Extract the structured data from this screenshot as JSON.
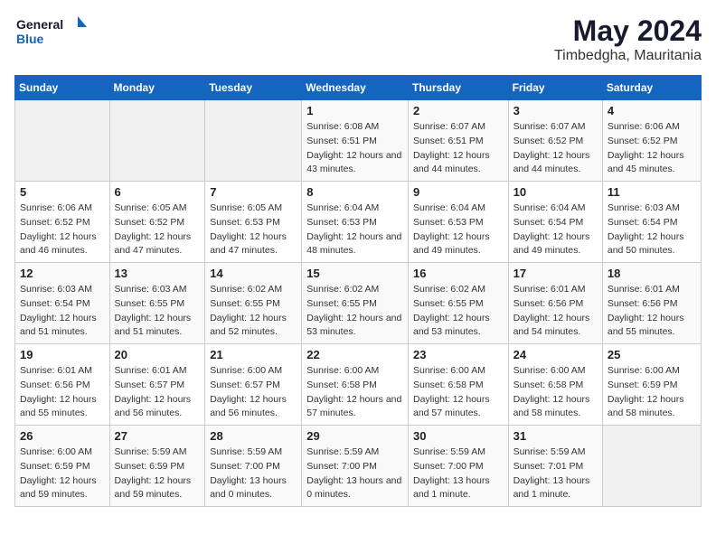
{
  "logo": {
    "text_general": "General",
    "text_blue": "Blue"
  },
  "title": "May 2024",
  "subtitle": "Timbedgha, Mauritania",
  "headers": [
    "Sunday",
    "Monday",
    "Tuesday",
    "Wednesday",
    "Thursday",
    "Friday",
    "Saturday"
  ],
  "weeks": [
    [
      {
        "day": "",
        "info": ""
      },
      {
        "day": "",
        "info": ""
      },
      {
        "day": "",
        "info": ""
      },
      {
        "day": "1",
        "sunrise": "Sunrise: 6:08 AM",
        "sunset": "Sunset: 6:51 PM",
        "daylight": "Daylight: 12 hours and 43 minutes."
      },
      {
        "day": "2",
        "sunrise": "Sunrise: 6:07 AM",
        "sunset": "Sunset: 6:51 PM",
        "daylight": "Daylight: 12 hours and 44 minutes."
      },
      {
        "day": "3",
        "sunrise": "Sunrise: 6:07 AM",
        "sunset": "Sunset: 6:52 PM",
        "daylight": "Daylight: 12 hours and 44 minutes."
      },
      {
        "day": "4",
        "sunrise": "Sunrise: 6:06 AM",
        "sunset": "Sunset: 6:52 PM",
        "daylight": "Daylight: 12 hours and 45 minutes."
      }
    ],
    [
      {
        "day": "5",
        "sunrise": "Sunrise: 6:06 AM",
        "sunset": "Sunset: 6:52 PM",
        "daylight": "Daylight: 12 hours and 46 minutes."
      },
      {
        "day": "6",
        "sunrise": "Sunrise: 6:05 AM",
        "sunset": "Sunset: 6:52 PM",
        "daylight": "Daylight: 12 hours and 47 minutes."
      },
      {
        "day": "7",
        "sunrise": "Sunrise: 6:05 AM",
        "sunset": "Sunset: 6:53 PM",
        "daylight": "Daylight: 12 hours and 47 minutes."
      },
      {
        "day": "8",
        "sunrise": "Sunrise: 6:04 AM",
        "sunset": "Sunset: 6:53 PM",
        "daylight": "Daylight: 12 hours and 48 minutes."
      },
      {
        "day": "9",
        "sunrise": "Sunrise: 6:04 AM",
        "sunset": "Sunset: 6:53 PM",
        "daylight": "Daylight: 12 hours and 49 minutes."
      },
      {
        "day": "10",
        "sunrise": "Sunrise: 6:04 AM",
        "sunset": "Sunset: 6:54 PM",
        "daylight": "Daylight: 12 hours and 49 minutes."
      },
      {
        "day": "11",
        "sunrise": "Sunrise: 6:03 AM",
        "sunset": "Sunset: 6:54 PM",
        "daylight": "Daylight: 12 hours and 50 minutes."
      }
    ],
    [
      {
        "day": "12",
        "sunrise": "Sunrise: 6:03 AM",
        "sunset": "Sunset: 6:54 PM",
        "daylight": "Daylight: 12 hours and 51 minutes."
      },
      {
        "day": "13",
        "sunrise": "Sunrise: 6:03 AM",
        "sunset": "Sunset: 6:55 PM",
        "daylight": "Daylight: 12 hours and 51 minutes."
      },
      {
        "day": "14",
        "sunrise": "Sunrise: 6:02 AM",
        "sunset": "Sunset: 6:55 PM",
        "daylight": "Daylight: 12 hours and 52 minutes."
      },
      {
        "day": "15",
        "sunrise": "Sunrise: 6:02 AM",
        "sunset": "Sunset: 6:55 PM",
        "daylight": "Daylight: 12 hours and 53 minutes."
      },
      {
        "day": "16",
        "sunrise": "Sunrise: 6:02 AM",
        "sunset": "Sunset: 6:55 PM",
        "daylight": "Daylight: 12 hours and 53 minutes."
      },
      {
        "day": "17",
        "sunrise": "Sunrise: 6:01 AM",
        "sunset": "Sunset: 6:56 PM",
        "daylight": "Daylight: 12 hours and 54 minutes."
      },
      {
        "day": "18",
        "sunrise": "Sunrise: 6:01 AM",
        "sunset": "Sunset: 6:56 PM",
        "daylight": "Daylight: 12 hours and 55 minutes."
      }
    ],
    [
      {
        "day": "19",
        "sunrise": "Sunrise: 6:01 AM",
        "sunset": "Sunset: 6:56 PM",
        "daylight": "Daylight: 12 hours and 55 minutes."
      },
      {
        "day": "20",
        "sunrise": "Sunrise: 6:01 AM",
        "sunset": "Sunset: 6:57 PM",
        "daylight": "Daylight: 12 hours and 56 minutes."
      },
      {
        "day": "21",
        "sunrise": "Sunrise: 6:00 AM",
        "sunset": "Sunset: 6:57 PM",
        "daylight": "Daylight: 12 hours and 56 minutes."
      },
      {
        "day": "22",
        "sunrise": "Sunrise: 6:00 AM",
        "sunset": "Sunset: 6:58 PM",
        "daylight": "Daylight: 12 hours and 57 minutes."
      },
      {
        "day": "23",
        "sunrise": "Sunrise: 6:00 AM",
        "sunset": "Sunset: 6:58 PM",
        "daylight": "Daylight: 12 hours and 57 minutes."
      },
      {
        "day": "24",
        "sunrise": "Sunrise: 6:00 AM",
        "sunset": "Sunset: 6:58 PM",
        "daylight": "Daylight: 12 hours and 58 minutes."
      },
      {
        "day": "25",
        "sunrise": "Sunrise: 6:00 AM",
        "sunset": "Sunset: 6:59 PM",
        "daylight": "Daylight: 12 hours and 58 minutes."
      }
    ],
    [
      {
        "day": "26",
        "sunrise": "Sunrise: 6:00 AM",
        "sunset": "Sunset: 6:59 PM",
        "daylight": "Daylight: 12 hours and 59 minutes."
      },
      {
        "day": "27",
        "sunrise": "Sunrise: 5:59 AM",
        "sunset": "Sunset: 6:59 PM",
        "daylight": "Daylight: 12 hours and 59 minutes."
      },
      {
        "day": "28",
        "sunrise": "Sunrise: 5:59 AM",
        "sunset": "Sunset: 7:00 PM",
        "daylight": "Daylight: 13 hours and 0 minutes."
      },
      {
        "day": "29",
        "sunrise": "Sunrise: 5:59 AM",
        "sunset": "Sunset: 7:00 PM",
        "daylight": "Daylight: 13 hours and 0 minutes."
      },
      {
        "day": "30",
        "sunrise": "Sunrise: 5:59 AM",
        "sunset": "Sunset: 7:00 PM",
        "daylight": "Daylight: 13 hours and 1 minute."
      },
      {
        "day": "31",
        "sunrise": "Sunrise: 5:59 AM",
        "sunset": "Sunset: 7:01 PM",
        "daylight": "Daylight: 13 hours and 1 minute."
      },
      {
        "day": "",
        "info": ""
      }
    ]
  ]
}
